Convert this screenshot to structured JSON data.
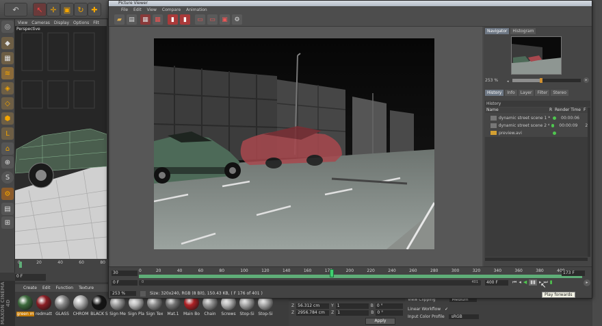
{
  "c4d": {
    "viewport_menu": [
      "View",
      "Cameras",
      "Display",
      "Options",
      "Filt"
    ],
    "viewport_label": "Perspective",
    "timeline_ticks": [
      "0",
      "20",
      "40",
      "60",
      "80"
    ],
    "frame_field": "0 F",
    "material_menu": [
      "Create",
      "Edit",
      "Function",
      "Texture"
    ],
    "materials": [
      "green m",
      "redmatt",
      "GLASS",
      "CHROM",
      "BLACK S",
      "Sign Me",
      "Sign Pla",
      "Sign Tex",
      "Mat.1",
      "Main Bo",
      "Chain",
      "Screws",
      "Stop-Si",
      "Stop-Si"
    ],
    "coords": {
      "row1": {
        "a": "Z",
        "av": "56.312 cm",
        "b": "Y",
        "bv": "1",
        "c": "B",
        "cv": "0 °"
      },
      "row2": {
        "a": "Z",
        "av": "2956.784 cm",
        "b": "Z",
        "bv": "1",
        "c": "B",
        "cv": "0 °"
      },
      "apply": "Apply"
    },
    "attributes": {
      "view_clipping": "View Clipping",
      "view_clipping_value": "Medium",
      "linear_workflow": "Linear Workflow",
      "linear_check": "✓",
      "input_color_profile": "Input Color Profile",
      "input_color_profile_value": "sRGB"
    },
    "logo": "MAXON CINEMA 4D"
  },
  "picture_viewer": {
    "title": "Picture Viewer",
    "menu": [
      "File",
      "Edit",
      "View",
      "Compare",
      "Animation"
    ],
    "side_tabs_top": [
      "Navigator",
      "Histogram"
    ],
    "zoom_value": "253 %",
    "side_tabs_bottom": [
      "History",
      "Info",
      "Layer",
      "Filter",
      "Stereo"
    ],
    "history_header": "History",
    "history_columns": {
      "name": "Name",
      "r": "R",
      "render_time": "Render Time",
      "f": "F"
    },
    "history_rows": [
      {
        "name": "dynamic street scene 1 *",
        "time": "00:00:06",
        "f": "0"
      },
      {
        "name": "dynamic street scene 2 *",
        "time": "00:00:09",
        "f": "20"
      },
      {
        "name": "preview.avi",
        "time": "",
        "f": ""
      }
    ],
    "ruler_ticks": [
      "20",
      "40",
      "60",
      "80",
      "100",
      "120",
      "140",
      "160",
      "173",
      "200",
      "220",
      "240",
      "260",
      "280",
      "300",
      "320",
      "340",
      "360",
      "380",
      "400"
    ],
    "ruler_start": "0",
    "left_field_top": "30",
    "left_field_bottom": "0 F",
    "right_field_top": "173 F",
    "right_field_bottom": "400 F",
    "scrub_start": "0",
    "scrub_end": "401",
    "status_zoom": "253 %",
    "status_text": "Size: 320x240, RGB (8 Bit), 150.43 KB,  ( F 176 of 401 )",
    "tooltip": "Play forwards",
    "playhead_fraction": 0.43
  },
  "colors": {
    "accent_green": "#5fae78",
    "tab_active": "#6d7784"
  }
}
